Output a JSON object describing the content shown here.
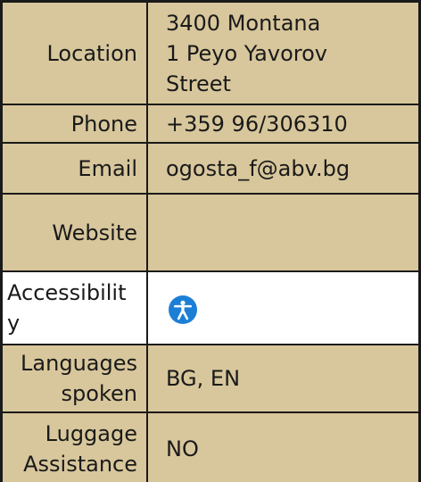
{
  "rows": {
    "location": {
      "label": "Location",
      "value_lines": [
        "3400 Montana",
        "1 Peyo Yavorov",
        "Street"
      ]
    },
    "phone": {
      "label": "Phone",
      "value": "+359 96/306310"
    },
    "email": {
      "label": "Email",
      "value": "ogosta_f@abv.bg"
    },
    "website": {
      "label": "Website",
      "value": ""
    },
    "accessibility": {
      "label_line1": "Accessibilit",
      "label_line2": "y",
      "icon": "accessibility-icon"
    },
    "languages": {
      "label_line1": "Languages",
      "label_line2": "spoken",
      "value": "BG, EN"
    },
    "luggage": {
      "label_line1": "Luggage",
      "label_line2": "Assistance",
      "value": "NO"
    }
  },
  "colors": {
    "row_tan": "#d8c79c",
    "row_white": "#ffffff",
    "border": "#1a1a1a",
    "accessibility_icon": "#1c7fd6"
  }
}
